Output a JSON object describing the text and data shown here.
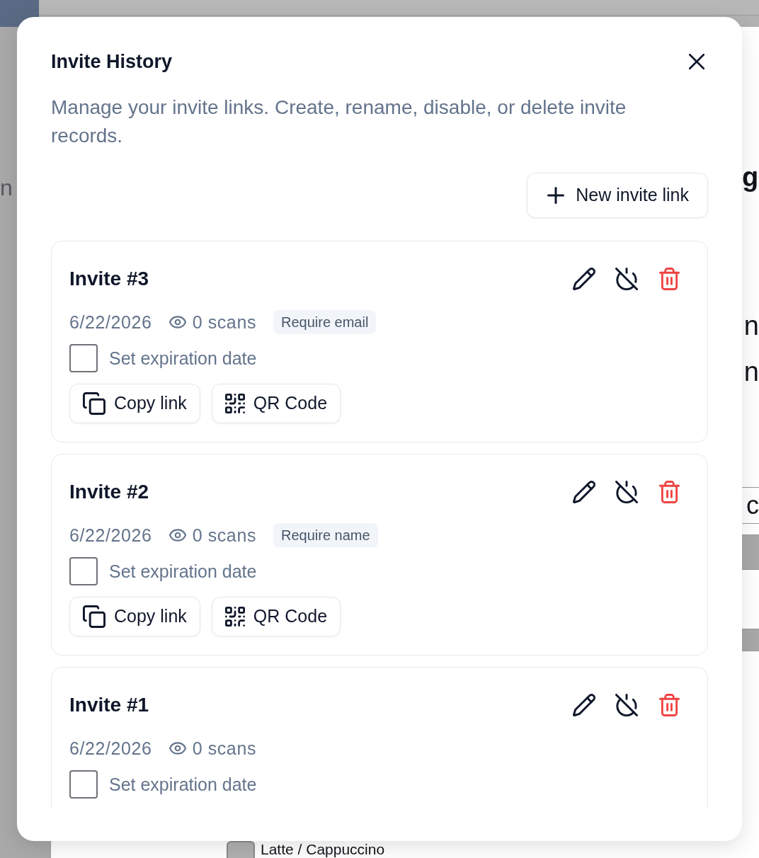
{
  "background": {
    "sidebar_text": "n",
    "edge_texts": [
      {
        "kind": "heading",
        "text": "g"
      },
      {
        "kind": "text",
        "text": "n"
      },
      {
        "kind": "text",
        "text": "n"
      },
      {
        "kind": "table_row",
        "text": "c"
      }
    ],
    "option": {
      "label": "Latte / Cappuccino",
      "checked": false
    }
  },
  "dialog": {
    "title": "Invite History",
    "description": "Manage your invite links. Create, rename, disable, or delete invite records.",
    "new_button": "New invite link",
    "invites": [
      {
        "name": "Invite #3",
        "date": "6/22/2026",
        "scans": "0 scans",
        "badge": "Require email",
        "expiration": {
          "label": "Set expiration date",
          "checked": false
        },
        "actions": [
          {
            "kind": "copy",
            "label": "Copy link"
          },
          {
            "kind": "qr",
            "label": "QR Code"
          }
        ]
      },
      {
        "name": "Invite #2",
        "date": "6/22/2026",
        "scans": "0 scans",
        "badge": "Require name",
        "expiration": {
          "label": "Set expiration date",
          "checked": false
        },
        "actions": [
          {
            "kind": "copy",
            "label": "Copy link"
          },
          {
            "kind": "qr",
            "label": "QR Code"
          }
        ]
      },
      {
        "name": "Invite #1",
        "date": "6/22/2026",
        "scans": "0 scans",
        "expiration": {
          "label": "Set expiration date",
          "checked": false
        }
      }
    ]
  }
}
